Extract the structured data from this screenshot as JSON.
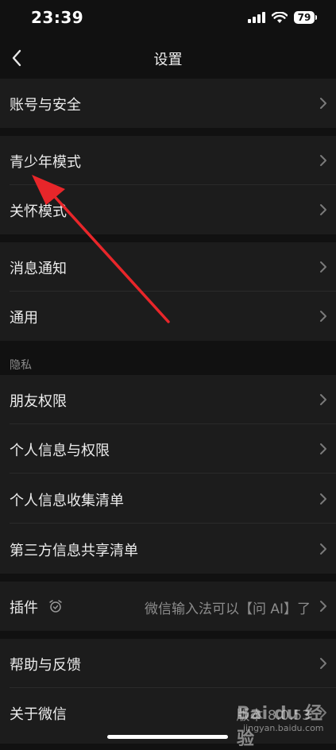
{
  "status_bar": {
    "time": "23:39",
    "battery_level": "79"
  },
  "nav": {
    "title": "设置"
  },
  "groups": {
    "account": {
      "label": "账号与安全"
    },
    "youth": {
      "label": "青少年模式"
    },
    "care": {
      "label": "关怀模式"
    },
    "notifications": {
      "label": "消息通知"
    },
    "general": {
      "label": "通用"
    }
  },
  "privacy": {
    "header": "隐私",
    "items": [
      {
        "label": "朋友权限"
      },
      {
        "label": "个人信息与权限"
      },
      {
        "label": "个人信息收集清单"
      },
      {
        "label": "第三方信息共享清单"
      }
    ]
  },
  "plugins": {
    "label": "插件",
    "value": "微信输入法可以【问 AI】了"
  },
  "help": {
    "label": "帮助与反馈"
  },
  "about": {
    "label": "关于微信",
    "value": "版本 8.0.53"
  },
  "watermark": {
    "logo": "Bai du 经验",
    "url": "jingyan.baidu.com"
  },
  "colors": {
    "background": "#111111",
    "row_background": "#1c1c1c",
    "annotation_arrow": "#e8262a"
  }
}
